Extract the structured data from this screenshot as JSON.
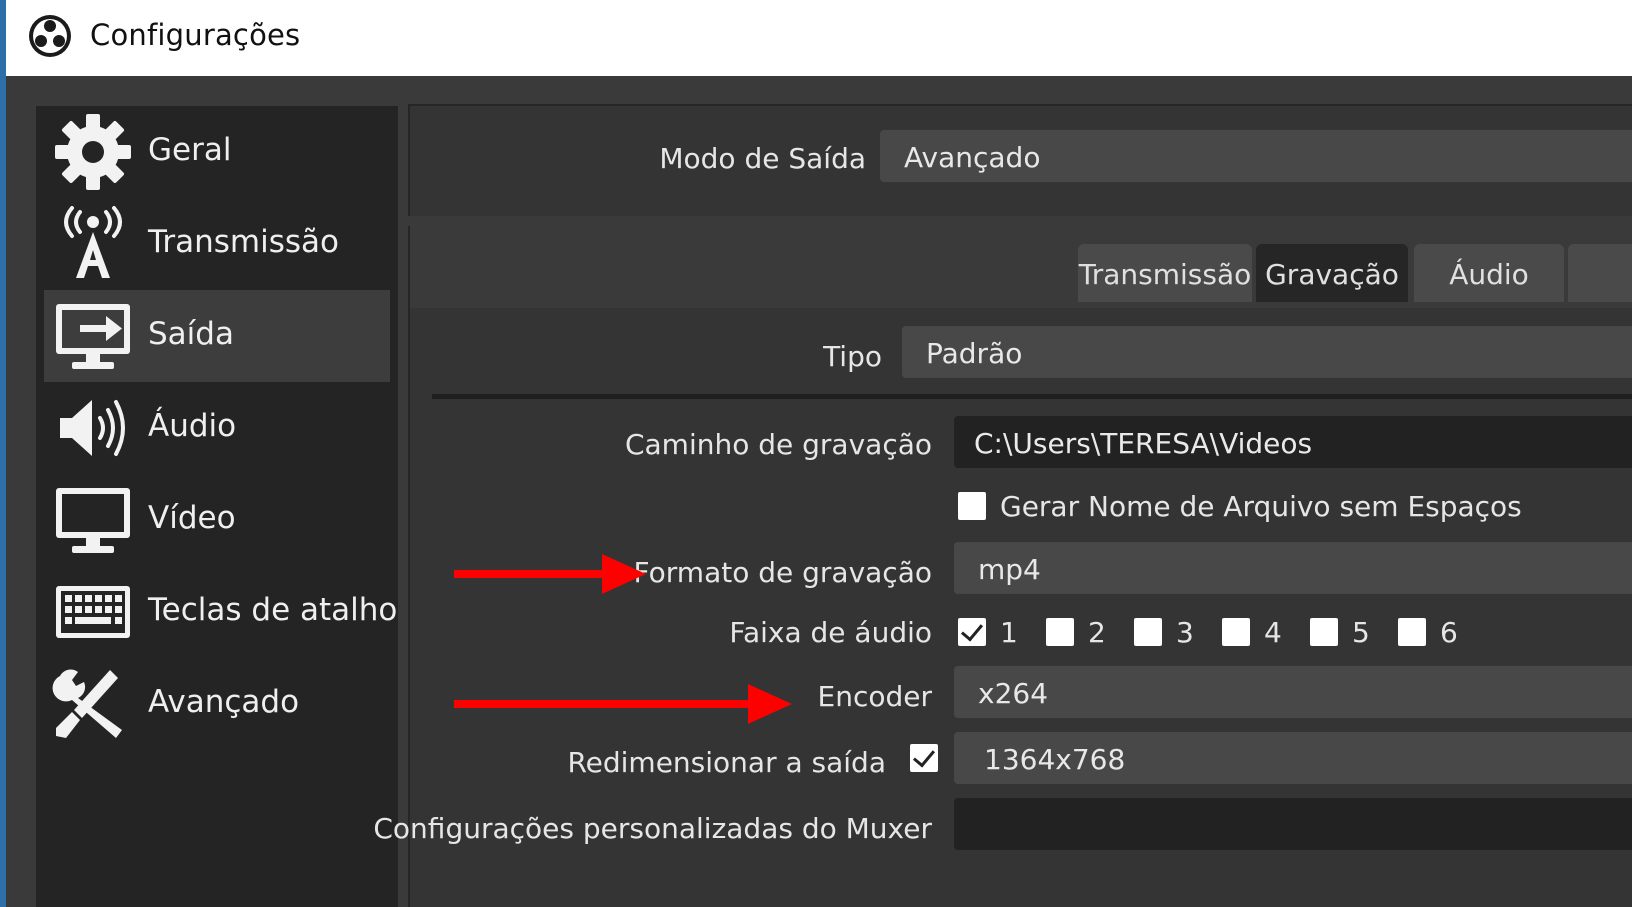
{
  "window": {
    "title": "Configurações"
  },
  "sidebar": {
    "items": [
      {
        "label": "Geral",
        "icon": "gear-icon"
      },
      {
        "label": "Transmissão",
        "icon": "broadcast-tower-icon"
      },
      {
        "label": "Saída",
        "icon": "output-monitor-icon",
        "active": true
      },
      {
        "label": "Áudio",
        "icon": "speaker-icon"
      },
      {
        "label": "Vídeo",
        "icon": "monitor-icon"
      },
      {
        "label": "Teclas de atalho",
        "icon": "keyboard-icon"
      },
      {
        "label": "Avançado",
        "icon": "tools-icon"
      }
    ]
  },
  "output_mode": {
    "label": "Modo de Saída",
    "value": "Avançado"
  },
  "tabs": [
    {
      "label": "Transmissão",
      "active": false
    },
    {
      "label": "Gravação",
      "active": true
    },
    {
      "label": "Áudio",
      "active": false
    }
  ],
  "recording": {
    "type": {
      "label": "Tipo",
      "value": "Padrão"
    },
    "path": {
      "label": "Caminho de gravação",
      "value": "C:\\Users\\TERESA\\Videos"
    },
    "no_space_filename": {
      "label": "Gerar Nome de Arquivo sem Espaços",
      "checked": false
    },
    "format": {
      "label": "Formato de gravação",
      "value": "mp4"
    },
    "audio_track": {
      "label": "Faixa de áudio",
      "tracks": [
        {
          "num": "1",
          "checked": true
        },
        {
          "num": "2",
          "checked": false
        },
        {
          "num": "3",
          "checked": false
        },
        {
          "num": "4",
          "checked": false
        },
        {
          "num": "5",
          "checked": false
        },
        {
          "num": "6",
          "checked": false
        }
      ]
    },
    "encoder": {
      "label": "Encoder",
      "value": "x264"
    },
    "rescale": {
      "label": "Redimensionar a saída",
      "checked": true,
      "value": "1364x768"
    },
    "muxer": {
      "label": "Configurações personalizadas do Muxer",
      "value": ""
    }
  },
  "colors": {
    "annotation_arrow": "#ff0000",
    "window_accent": "#2f6fa8"
  }
}
